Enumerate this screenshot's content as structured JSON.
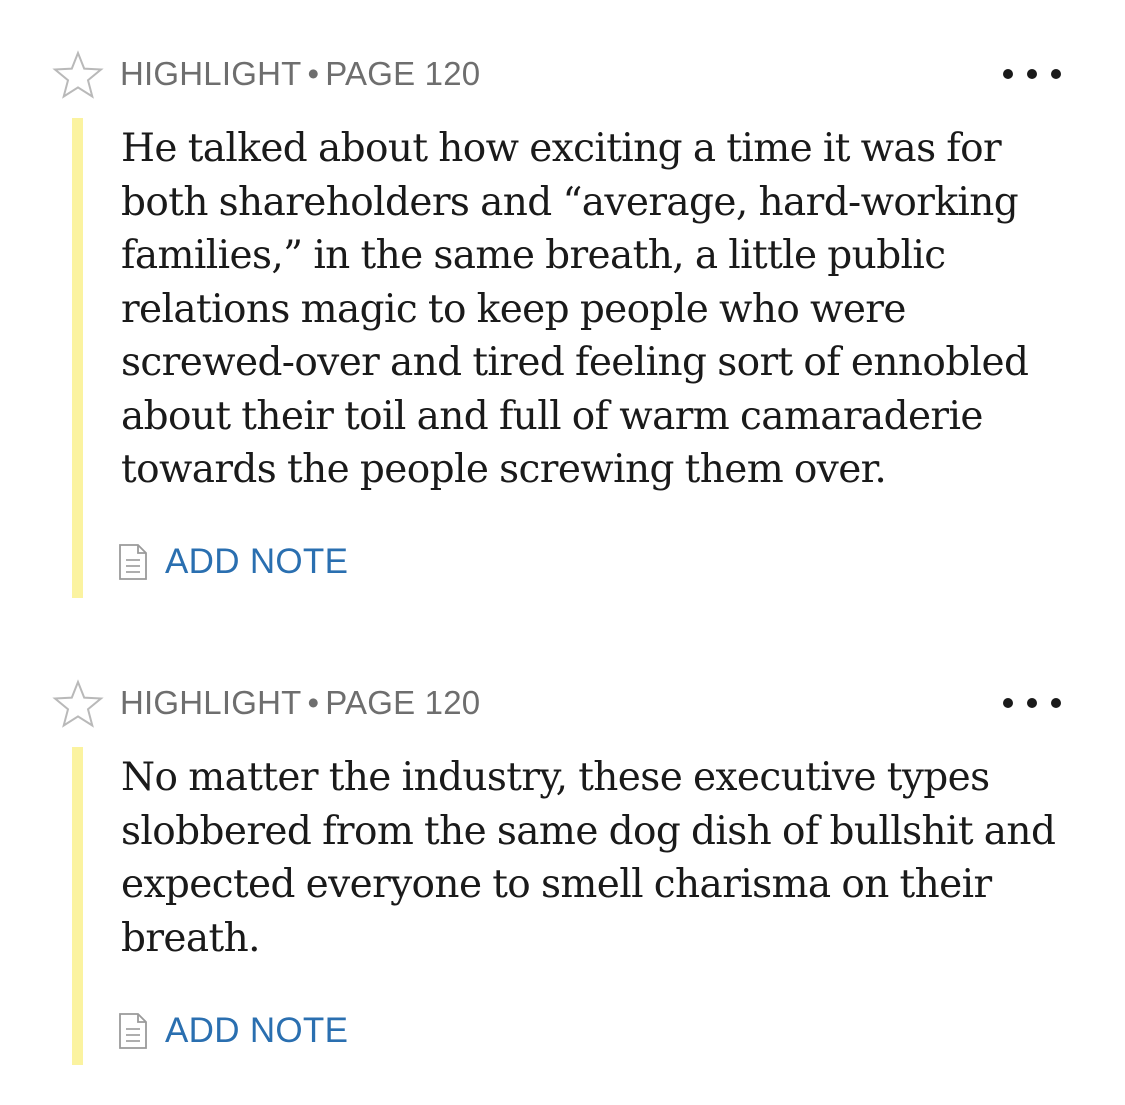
{
  "colors": {
    "highlight_bar": "#fbf3a0",
    "meta_text": "#6e6e6e",
    "link": "#2a6fb0",
    "quote_text": "#1a1a1a"
  },
  "icons": {
    "favorite": "star-outline-icon",
    "more": "more-horizontal-icon",
    "note": "note-icon"
  },
  "highlights": [
    {
      "kind": "HIGHLIGHT",
      "separator": "•",
      "location": "PAGE 120",
      "text": "He talked about how exciting a time it was for both shareholders and “average, hard-working families,” in the same breath, a little public relations magic to keep people who were screwed-over and tired feeling sort of ennobled about their toil and full of warm camaraderie towards the people screwing them over.",
      "add_note_label": "ADD NOTE"
    },
    {
      "kind": "HIGHLIGHT",
      "separator": "•",
      "location": "PAGE 120",
      "text": "No matter the industry, these executive types slobbered from the same dog dish of bullshit and expected everyone to smell charisma on their breath.",
      "add_note_label": "ADD NOTE"
    }
  ]
}
